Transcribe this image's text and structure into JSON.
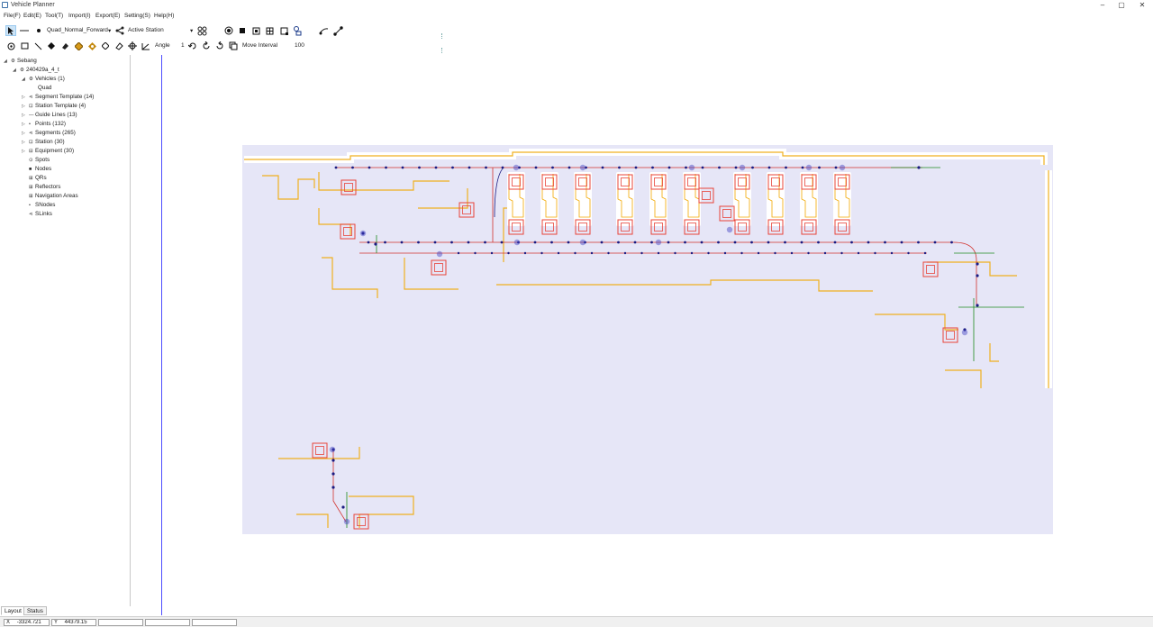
{
  "window": {
    "title": "Vehicle Planner",
    "minimize": "–",
    "maximize": "▢",
    "close": "✕"
  },
  "menu": [
    "File(F)",
    "Edit(E)",
    "Tool(T)",
    "Import(I)",
    "Export(E)",
    "Setting(S)",
    "Help(H)"
  ],
  "toolbar1": {
    "vehicle_select": "Quad_Normal_Forward",
    "station_select": "Active Station"
  },
  "toolbar2": {
    "angle_label": "Angle",
    "angle_value": "1",
    "move_interval_label": "Move Interval",
    "move_interval_value": "100"
  },
  "tree": [
    {
      "label": "Sebang",
      "level": 0,
      "expanded": true,
      "icon": "project-icon"
    },
    {
      "label": "240429a_4_t",
      "level": 1,
      "expanded": true,
      "icon": "map-icon"
    },
    {
      "label": "Vehicles (1)",
      "level": 2,
      "expanded": true,
      "icon": "vehicle-icon"
    },
    {
      "label": "Quad",
      "level": 3,
      "expanded": null,
      "icon": ""
    },
    {
      "label": "Segment Template (14)",
      "level": 2,
      "expanded": false,
      "icon": "segment-template-icon"
    },
    {
      "label": "Station Template (4)",
      "level": 2,
      "expanded": false,
      "icon": "station-template-icon"
    },
    {
      "label": "Guide Lines (13)",
      "level": 2,
      "expanded": false,
      "icon": "guide-line-icon"
    },
    {
      "label": "Points (132)",
      "level": 2,
      "expanded": false,
      "icon": "point-icon"
    },
    {
      "label": "Segments (265)",
      "level": 2,
      "expanded": false,
      "icon": "segment-icon"
    },
    {
      "label": "Station (30)",
      "level": 2,
      "expanded": false,
      "icon": "station-icon"
    },
    {
      "label": "Equipment (30)",
      "level": 2,
      "expanded": false,
      "icon": "equipment-icon"
    },
    {
      "label": "Spots",
      "level": 2,
      "expanded": null,
      "icon": "spot-icon"
    },
    {
      "label": "Nodes",
      "level": 2,
      "expanded": null,
      "icon": "node-icon"
    },
    {
      "label": "QRs",
      "level": 2,
      "expanded": null,
      "icon": "qr-icon"
    },
    {
      "label": "Reflectors",
      "level": 2,
      "expanded": null,
      "icon": "reflector-icon"
    },
    {
      "label": "Navigation Areas",
      "level": 2,
      "expanded": null,
      "icon": "nav-area-icon"
    },
    {
      "label": "SNodes",
      "level": 2,
      "expanded": null,
      "icon": "snode-icon"
    },
    {
      "label": "SLinks",
      "level": 2,
      "expanded": null,
      "icon": "slink-icon"
    }
  ],
  "bottom_tabs": [
    "Layout",
    "Status"
  ],
  "status": {
    "x_label": "X",
    "x_value": "-3324.721",
    "y_label": "Y",
    "y_value": "44379.15"
  },
  "colors": {
    "map_bg": "#e6e6f7",
    "map_border": "#f3a900",
    "path": "#d2322d",
    "node": "#1a1a80",
    "station": "#e8443a",
    "guide": "#1e8a1e",
    "selection_line": "#4d4dff"
  }
}
